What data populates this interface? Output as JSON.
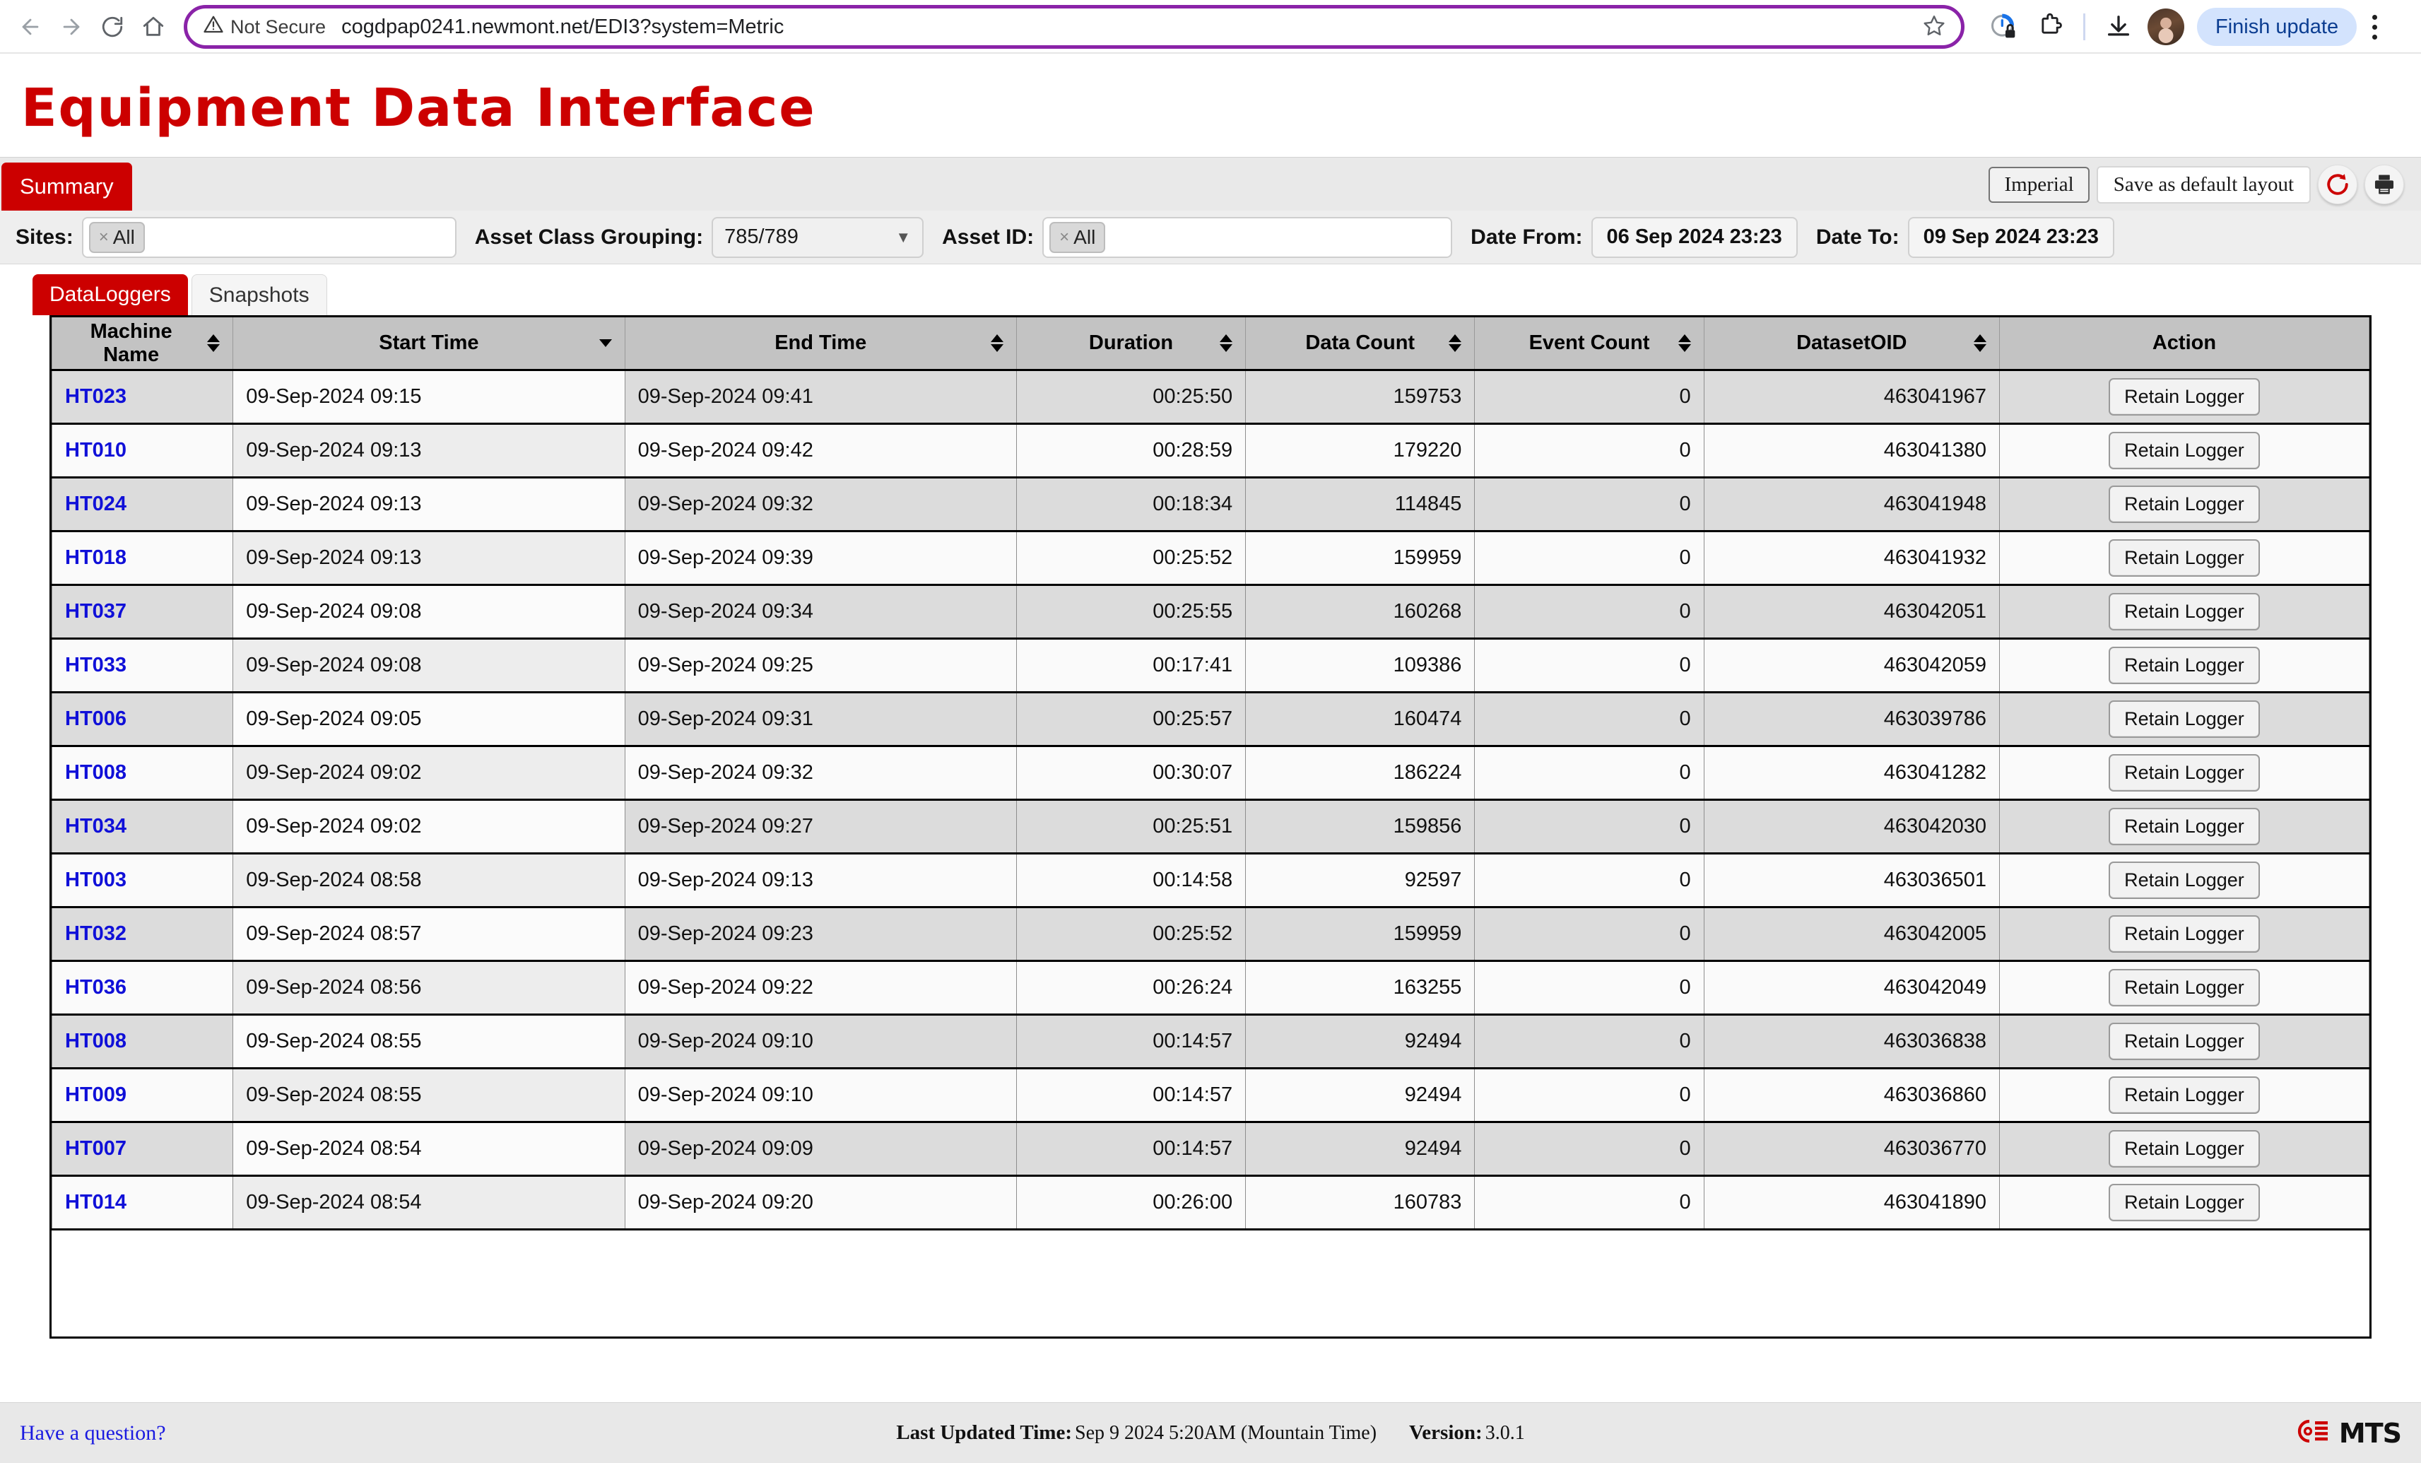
{
  "browser": {
    "security_label": "Not Secure",
    "url": "cogdpap0241.newmont.net/EDI3?system=Metric",
    "finish_update_label": "Finish update",
    "icons": {
      "back": "back-arrow-icon",
      "forward": "forward-arrow-icon",
      "reload": "reload-icon",
      "home": "home-icon",
      "warning": "warning-triangle-icon",
      "bookmark": "star-icon",
      "performance": "performance-lock-icon",
      "extensions": "extensions-puzzle-icon",
      "downloads": "download-icon",
      "profile": "avatar-icon",
      "menu": "kebab-menu-icon"
    }
  },
  "app": {
    "title": "Equipment Data Interface",
    "accent_red": "#cc0000",
    "link_blue": "#1010d8"
  },
  "summary_bar": {
    "tab_label": "Summary",
    "imperial_label": "Imperial",
    "save_layout_label": "Save as default layout",
    "refresh_icon": "refresh-icon",
    "print_icon": "printer-icon"
  },
  "filters": {
    "sites_label": "Sites:",
    "sites_chip": "All",
    "asset_class_label": "Asset Class Grouping:",
    "asset_class_value": "785/789",
    "asset_id_label": "Asset ID:",
    "asset_id_chip": "All",
    "date_from_label": "Date From:",
    "date_from_value": "06 Sep 2024 23:23",
    "date_to_label": "Date To:",
    "date_to_value": "09 Sep 2024 23:23",
    "chip_remove_glyph": "×",
    "caret_glyph": "▼"
  },
  "tabs": [
    {
      "label": "DataLoggers",
      "active": true
    },
    {
      "label": "Snapshots",
      "active": false
    }
  ],
  "table": {
    "columns": [
      {
        "label": "Machine Name",
        "sort": "both"
      },
      {
        "label": "Start Time",
        "sort": "desc"
      },
      {
        "label": "End Time",
        "sort": "both"
      },
      {
        "label": "Duration",
        "sort": "both"
      },
      {
        "label": "Data Count",
        "sort": "both"
      },
      {
        "label": "Event Count",
        "sort": "both"
      },
      {
        "label": "DatasetOID",
        "sort": "both"
      },
      {
        "label": "Action",
        "sort": "none"
      }
    ],
    "action_button_label": "Retain Logger",
    "rows": [
      {
        "machine": "HT023",
        "start": "09-Sep-2024 09:15",
        "end": "09-Sep-2024 09:41",
        "duration": "00:25:50",
        "data_count": "159753",
        "event_count": "0",
        "oid": "463041967"
      },
      {
        "machine": "HT010",
        "start": "09-Sep-2024 09:13",
        "end": "09-Sep-2024 09:42",
        "duration": "00:28:59",
        "data_count": "179220",
        "event_count": "0",
        "oid": "463041380"
      },
      {
        "machine": "HT024",
        "start": "09-Sep-2024 09:13",
        "end": "09-Sep-2024 09:32",
        "duration": "00:18:34",
        "data_count": "114845",
        "event_count": "0",
        "oid": "463041948"
      },
      {
        "machine": "HT018",
        "start": "09-Sep-2024 09:13",
        "end": "09-Sep-2024 09:39",
        "duration": "00:25:52",
        "data_count": "159959",
        "event_count": "0",
        "oid": "463041932"
      },
      {
        "machine": "HT037",
        "start": "09-Sep-2024 09:08",
        "end": "09-Sep-2024 09:34",
        "duration": "00:25:55",
        "data_count": "160268",
        "event_count": "0",
        "oid": "463042051"
      },
      {
        "machine": "HT033",
        "start": "09-Sep-2024 09:08",
        "end": "09-Sep-2024 09:25",
        "duration": "00:17:41",
        "data_count": "109386",
        "event_count": "0",
        "oid": "463042059"
      },
      {
        "machine": "HT006",
        "start": "09-Sep-2024 09:05",
        "end": "09-Sep-2024 09:31",
        "duration": "00:25:57",
        "data_count": "160474",
        "event_count": "0",
        "oid": "463039786"
      },
      {
        "machine": "HT008",
        "start": "09-Sep-2024 09:02",
        "end": "09-Sep-2024 09:32",
        "duration": "00:30:07",
        "data_count": "186224",
        "event_count": "0",
        "oid": "463041282"
      },
      {
        "machine": "HT034",
        "start": "09-Sep-2024 09:02",
        "end": "09-Sep-2024 09:27",
        "duration": "00:25:51",
        "data_count": "159856",
        "event_count": "0",
        "oid": "463042030"
      },
      {
        "machine": "HT003",
        "start": "09-Sep-2024 08:58",
        "end": "09-Sep-2024 09:13",
        "duration": "00:14:58",
        "data_count": "92597",
        "event_count": "0",
        "oid": "463036501"
      },
      {
        "machine": "HT032",
        "start": "09-Sep-2024 08:57",
        "end": "09-Sep-2024 09:23",
        "duration": "00:25:52",
        "data_count": "159959",
        "event_count": "0",
        "oid": "463042005"
      },
      {
        "machine": "HT036",
        "start": "09-Sep-2024 08:56",
        "end": "09-Sep-2024 09:22",
        "duration": "00:26:24",
        "data_count": "163255",
        "event_count": "0",
        "oid": "463042049"
      },
      {
        "machine": "HT008",
        "start": "09-Sep-2024 08:55",
        "end": "09-Sep-2024 09:10",
        "duration": "00:14:57",
        "data_count": "92494",
        "event_count": "0",
        "oid": "463036838"
      },
      {
        "machine": "HT009",
        "start": "09-Sep-2024 08:55",
        "end": "09-Sep-2024 09:10",
        "duration": "00:14:57",
        "data_count": "92494",
        "event_count": "0",
        "oid": "463036860"
      },
      {
        "machine": "HT007",
        "start": "09-Sep-2024 08:54",
        "end": "09-Sep-2024 09:09",
        "duration": "00:14:57",
        "data_count": "92494",
        "event_count": "0",
        "oid": "463036770"
      },
      {
        "machine": "HT014",
        "start": "09-Sep-2024 08:54",
        "end": "09-Sep-2024 09:20",
        "duration": "00:26:00",
        "data_count": "160783",
        "event_count": "0",
        "oid": "463041890"
      }
    ]
  },
  "footer": {
    "question_link": "Have a question?",
    "last_updated_label": "Last Updated Time:",
    "last_updated_value": "Sep 9 2024 5:20AM (Mountain Time)",
    "version_label": "Version:",
    "version_value": "3.0.1",
    "logo_text": "MTS",
    "logo_icon": "mts-logo-icon"
  }
}
